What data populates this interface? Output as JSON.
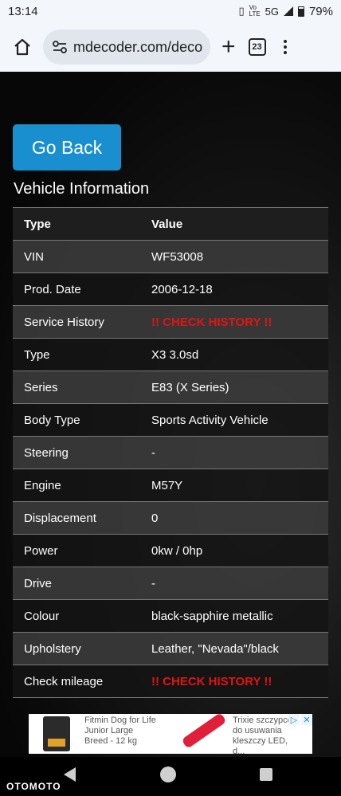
{
  "status_bar": {
    "time": "13:14",
    "network": "5G",
    "volte": "Vo LTE",
    "battery": "79%"
  },
  "browser": {
    "url": "mdecoder.com/deco",
    "tab_count": "23"
  },
  "page": {
    "go_back_label": "Go Back",
    "section_title": "Vehicle Information",
    "table_headers": [
      "Type",
      "Value"
    ],
    "rows": [
      {
        "label": "VIN",
        "value": "WF53008"
      },
      {
        "label": "Prod. Date",
        "value": "2006-12-18"
      },
      {
        "label": "Service History",
        "value": "!! CHECK HISTORY !!"
      },
      {
        "label": "Type",
        "value": "X3 3.0sd"
      },
      {
        "label": "Series",
        "value": "E83 (X Series)"
      },
      {
        "label": "Body Type",
        "value": "Sports Activity Vehicle"
      },
      {
        "label": "Steering",
        "value": "-"
      },
      {
        "label": "Engine",
        "value": "M57Y"
      },
      {
        "label": "Displacement",
        "value": "0"
      },
      {
        "label": "Power",
        "value": "0kw / 0hp"
      },
      {
        "label": "Drive",
        "value": "-"
      },
      {
        "label": "Colour",
        "value": "black-sapphire metallic"
      },
      {
        "label": "Upholstery",
        "value": "Leather, \"Nevada\"/black"
      },
      {
        "label": "Check mileage",
        "value": "!! CHECK HISTORY !!"
      }
    ]
  },
  "ad": {
    "text1": "Fitmin Dog for Life Junior Large Breed - 12 kg",
    "text2": "Trixie szczypce do usuwania kleszczy LED, d..."
  },
  "watermark": "OTOMOTO",
  "colors": {
    "accent": "#1a8fd0",
    "warning": "#e31414"
  }
}
